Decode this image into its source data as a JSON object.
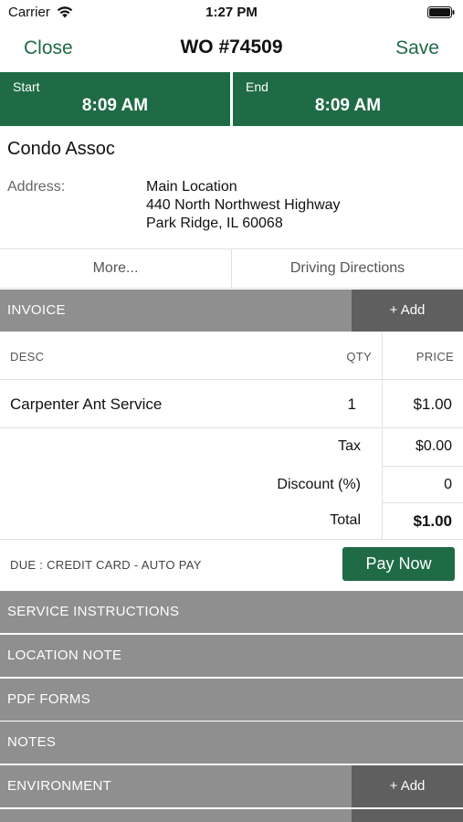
{
  "status_bar": {
    "carrier": "Carrier",
    "time": "1:27 PM"
  },
  "nav": {
    "close_label": "Close",
    "title": "WO #74509",
    "save_label": "Save"
  },
  "times": {
    "start_label": "Start",
    "start_value": "8:09 AM",
    "end_label": "End",
    "end_value": "8:09 AM"
  },
  "client": {
    "name": "Condo Assoc",
    "address_label": "Address:",
    "address_lines": [
      "Main Location",
      "440 North Northwest Highway",
      "Park Ridge, IL 60068"
    ]
  },
  "links": {
    "more": "More...",
    "directions": "Driving Directions"
  },
  "invoice": {
    "section_title": "INVOICE",
    "add_label": "+ Add",
    "headers": {
      "desc": "DESC",
      "qty": "QTY",
      "price": "PRICE"
    },
    "items": [
      {
        "desc": "Carpenter Ant Service",
        "qty": "1",
        "price": "$1.00"
      }
    ],
    "tax_label": "Tax",
    "tax_value": "$0.00",
    "discount_label": "Discount (%)",
    "discount_value": "0",
    "total_label": "Total",
    "total_value": "$1.00",
    "due_text": "DUE : CREDIT CARD - AUTO PAY",
    "pay_now_label": "Pay Now"
  },
  "sections": {
    "service_instructions": "SERVICE INSTRUCTIONS",
    "location_note": "LOCATION NOTE",
    "pdf_forms": "PDF FORMS",
    "notes": "NOTES",
    "environment": "ENVIRONMENT",
    "environment_add": "+ Add"
  },
  "colors": {
    "brand_green": "#1f6b45",
    "section_gray": "#8f8f8f",
    "add_gray": "#5f5f5f"
  }
}
